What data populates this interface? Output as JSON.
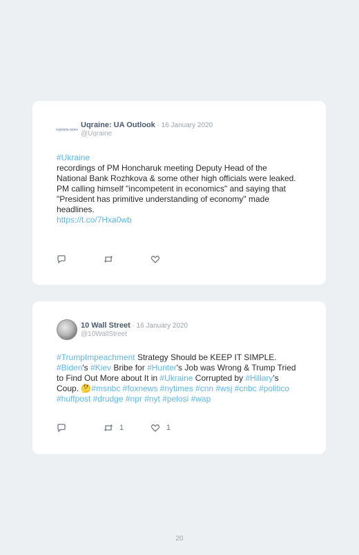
{
  "tweets": [
    {
      "avatar_text": "UQRAINE.NEWS",
      "name": "Uqraine: UA Outlook",
      "date": " · 16 January 2020",
      "handle": "@Uqraine",
      "segments": [
        {
          "text": "#Ukraine",
          "tag": true
        },
        {
          "text": "\nrecordings of PM Honcharuk meeting Deputy Head of the National Bank Rozhkova & some other high officials were leaked.\nPM calling himself \"incompetent in economics\" and saying that \"President has primitive understanding of economy\" made headlines.\n",
          "tag": false
        },
        {
          "text": "https://t.co/7Hxa0wb",
          "tag": true
        }
      ],
      "retweets": "",
      "likes": ""
    },
    {
      "name": "10 Wall Street",
      "date": " · 16 January 2020",
      "handle": "@10WallStreet",
      "segments": [
        {
          "text": "#TrumpImpeachment",
          "tag": true
        },
        {
          "text": " Strategy Should be KEEP IT SIMPLE.\n",
          "tag": false
        },
        {
          "text": "#Biden",
          "tag": true
        },
        {
          "text": "'s ",
          "tag": false
        },
        {
          "text": "#Kiev",
          "tag": true
        },
        {
          "text": " Bribe for ",
          "tag": false
        },
        {
          "text": "#Hunter",
          "tag": true
        },
        {
          "text": "'s Job was Wrong & Trump Tried to Find Out More about It in ",
          "tag": false
        },
        {
          "text": "#Ukraine",
          "tag": true
        },
        {
          "text": " Corrupted by ",
          "tag": false
        },
        {
          "text": "#Hillary",
          "tag": true
        },
        {
          "text": "'s Coup. 🤔",
          "tag": false
        },
        {
          "text": "#msnbc #foxnews #nytimes #cnn #wsj #cnbc #politico #huffpost #drudge #npr #nyt #pelosi #wap",
          "tag": true
        }
      ],
      "retweets": "1",
      "likes": "1"
    }
  ],
  "page_number": "20",
  "colors": {
    "hashtag": "#5bb7e6",
    "background": "#edf0f3",
    "card": "#ffffff"
  },
  "icons": [
    "reply-icon",
    "retweet-icon",
    "like-icon"
  ]
}
